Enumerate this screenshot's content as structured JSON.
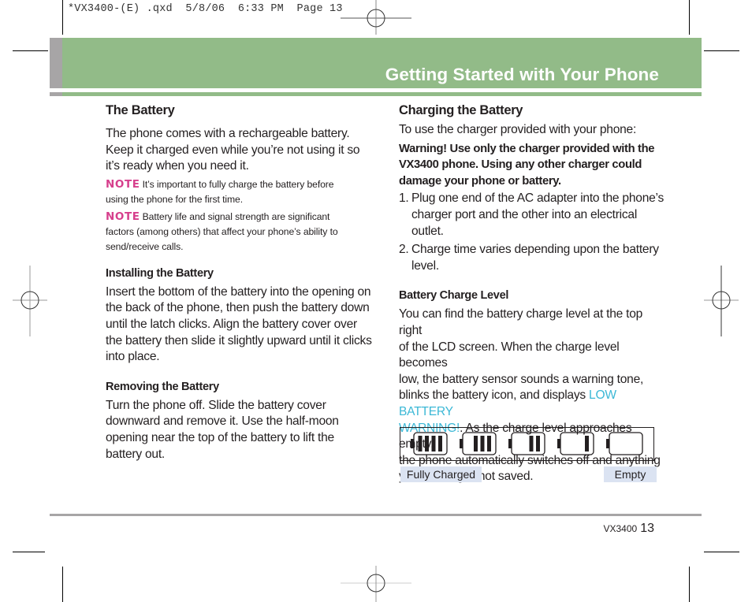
{
  "print_slug": "*VX3400-(E) .qxd  5/8/06  6:33 PM  Page 13",
  "header": {
    "title": "Getting Started with Your Phone",
    "colors": {
      "band_green": "#92bb88",
      "band_gray": "#a7a5a6",
      "title_text": "#ffffff"
    }
  },
  "left_column": {
    "section_title": "The Battery",
    "intro": [
      "The phone comes with a rechargeable battery.",
      "Keep it charged even while you’re not using it so",
      "it’s ready when you need it."
    ],
    "notes": [
      {
        "tag": "NOTE",
        "lines": [
          "It’s important to fully charge the battery before",
          "using the phone for the first time."
        ]
      },
      {
        "tag": "NOTE",
        "lines": [
          "Battery life and signal strength are significant",
          "factors (among others) that affect your phone’s ability to",
          "send/receive calls."
        ]
      }
    ],
    "installing": {
      "title": "Installing the Battery",
      "lines": [
        "Insert the bottom of the battery into the opening on",
        "the back of the phone, then push the battery down",
        "until the latch clicks. Align the battery cover over",
        "the battery then slide it slightly upward until it clicks",
        "into place."
      ]
    },
    "removing": {
      "title": "Removing the Battery",
      "lines": [
        "Turn the phone off. Slide the battery cover",
        "downward and remove it. Use the half-moon",
        "opening near the top of the battery to lift the",
        "battery out."
      ]
    }
  },
  "right_column": {
    "section_title": "Charging the Battery",
    "intro": "To use the charger provided with your phone:",
    "warning": [
      "Warning! Use only the charger provided with the",
      "VX3400 phone. Using any other charger could",
      "damage your phone or battery."
    ],
    "steps": [
      {
        "num": "1.",
        "lines": [
          "Plug one end of the AC adapter into the phone’s",
          "charger port and the other into an electrical",
          "outlet."
        ]
      },
      {
        "num": "2.",
        "lines": [
          "Charge time varies depending upon the battery",
          "level."
        ]
      }
    ],
    "charge_level": {
      "title": "Battery Charge Level",
      "line1": "You can find the battery charge level at the top right",
      "line2": "of the LCD screen. When the charge level becomes",
      "line3": "low, the battery sensor sounds a warning tone,",
      "line4_pre": "blinks the battery icon, and displays ",
      "line4_highlight": "LOW BATTERY",
      "line5_highlight": "WARNING!",
      "line5_post": ". As the charge level approaches empty,",
      "line6": "the phone automatically switches off and anything",
      "line7": "you’re doing is not saved.",
      "highlight_color": "#3bb8d6"
    },
    "battery_indicator": {
      "levels_bars": [
        4,
        3,
        2,
        1,
        0
      ],
      "max_bars": 4,
      "label_full": "Fully Charged",
      "label_empty": "Empty"
    }
  },
  "footer": {
    "model": "VX3400",
    "page_number": "13"
  }
}
